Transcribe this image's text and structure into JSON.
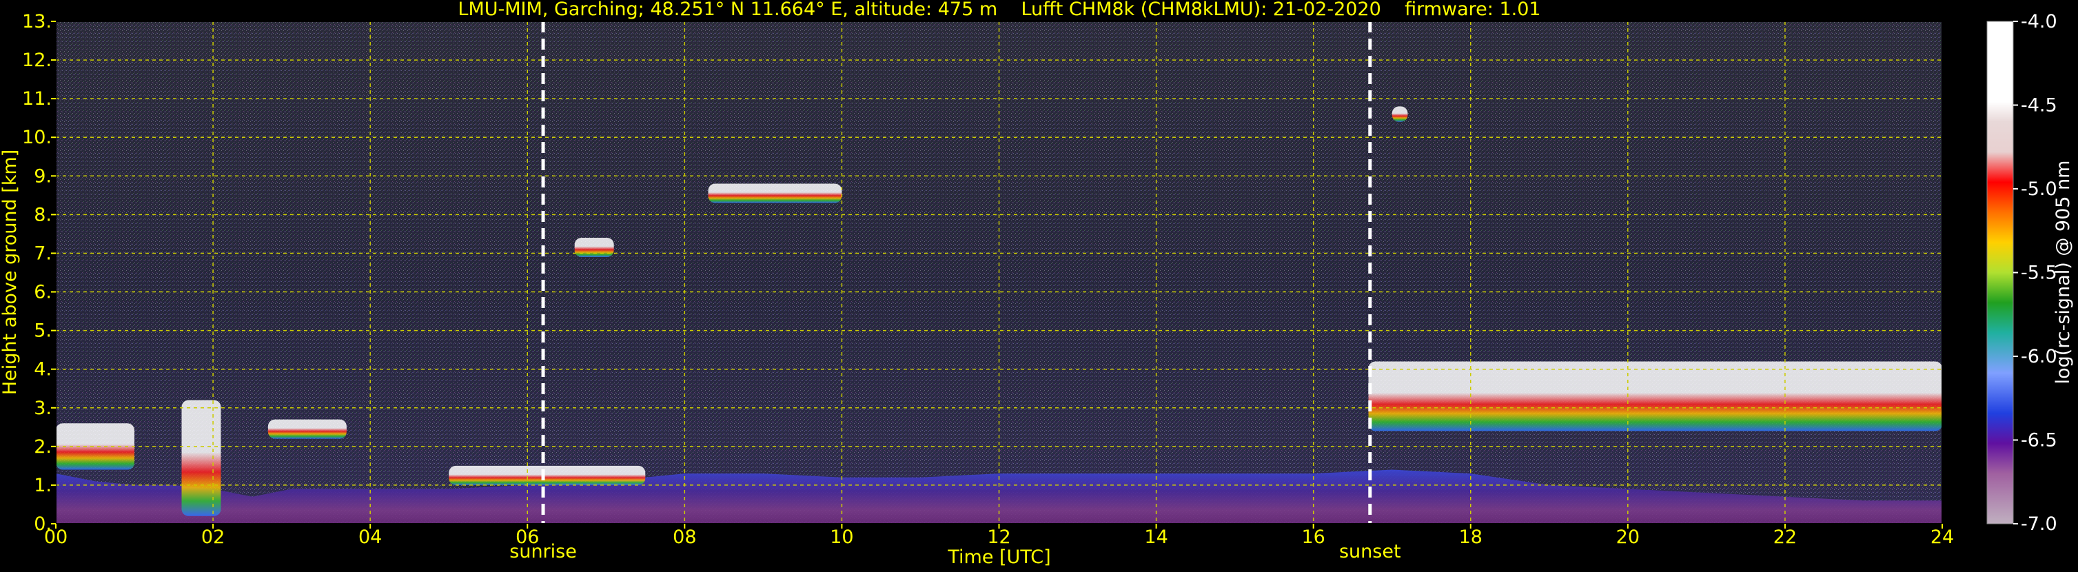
{
  "chart_data": {
    "type": "heatmap",
    "title": "LMU-MIM, Garching; 48.251° N 11.664° E, altitude: 475 m    Lufft CHM8k (CHM8kLMU): 21-02-2020    firmware: 1.01",
    "xlabel": "Time [UTC]",
    "ylabel": "Height above ground [km]",
    "colorbar_label": "log(rc-signal) @ 905 nm",
    "xlim": [
      0,
      24
    ],
    "ylim": [
      0,
      13
    ],
    "clim": [
      -7.0,
      -4.0
    ],
    "x_ticks": [
      0,
      2,
      4,
      6,
      8,
      10,
      12,
      14,
      16,
      18,
      20,
      22,
      24
    ],
    "x_tick_labels": [
      "00",
      "02",
      "04",
      "06",
      "08",
      "10",
      "12",
      "14",
      "16",
      "18",
      "20",
      "22",
      "24"
    ],
    "y_ticks": [
      0,
      1,
      2,
      3,
      4,
      5,
      6,
      7,
      8,
      9,
      10,
      11,
      12,
      13
    ],
    "y_tick_labels": [
      "0.",
      "1.",
      "2.",
      "3.",
      "4.",
      "5.",
      "6.",
      "7.",
      "8.",
      "9.",
      "10.",
      "11.",
      "12.",
      "13."
    ],
    "cbar_ticks": [
      -4.0,
      -4.5,
      -5.0,
      -5.5,
      -6.0,
      -6.5,
      -7.0
    ],
    "cbar_tick_labels": [
      "-4.0",
      "-4.5",
      "-5.0",
      "-5.5",
      "-6.0",
      "-6.5",
      "-7.0"
    ],
    "grid": true,
    "markers": [
      {
        "label": "sunrise",
        "x": 6.2
      },
      {
        "label": "sunset",
        "x": 16.72
      }
    ],
    "features": {
      "boundary_layer": [
        [
          0,
          1.3
        ],
        [
          0.5,
          1.1
        ],
        [
          1,
          1.0
        ],
        [
          1.5,
          1.0
        ],
        [
          2,
          0.9
        ],
        [
          2.5,
          0.7
        ],
        [
          3,
          0.9
        ],
        [
          4,
          0.9
        ],
        [
          5,
          0.9
        ],
        [
          6,
          1.0
        ],
        [
          7,
          1.1
        ],
        [
          8,
          1.3
        ],
        [
          9,
          1.3
        ],
        [
          10,
          1.2
        ],
        [
          11,
          1.2
        ],
        [
          12,
          1.3
        ],
        [
          13,
          1.3
        ],
        [
          14,
          1.3
        ],
        [
          15,
          1.3
        ],
        [
          16,
          1.3
        ],
        [
          17,
          1.4
        ],
        [
          18,
          1.3
        ],
        [
          19,
          1.0
        ],
        [
          20,
          0.9
        ],
        [
          21,
          0.8
        ],
        [
          22,
          0.7
        ],
        [
          23,
          0.6
        ],
        [
          24,
          0.6
        ]
      ],
      "cloud_layers": [
        {
          "t": [
            0,
            1.0
          ],
          "h": [
            1.4,
            2.6
          ]
        },
        {
          "t": [
            1.6,
            2.1
          ],
          "h": [
            0.2,
            3.2
          ]
        },
        {
          "t": [
            2.7,
            3.7
          ],
          "h": [
            2.2,
            2.7
          ]
        },
        {
          "t": [
            5.0,
            7.5
          ],
          "h": [
            1.0,
            1.5
          ]
        },
        {
          "t": [
            6.6,
            7.1
          ],
          "h": [
            6.9,
            7.4
          ]
        },
        {
          "t": [
            8.3,
            10.0
          ],
          "h": [
            8.3,
            8.8
          ]
        },
        {
          "t": [
            17.0,
            17.2
          ],
          "h": [
            10.4,
            10.8
          ]
        },
        {
          "t": [
            16.7,
            24.0
          ],
          "h": [
            2.4,
            4.2
          ]
        }
      ]
    }
  }
}
